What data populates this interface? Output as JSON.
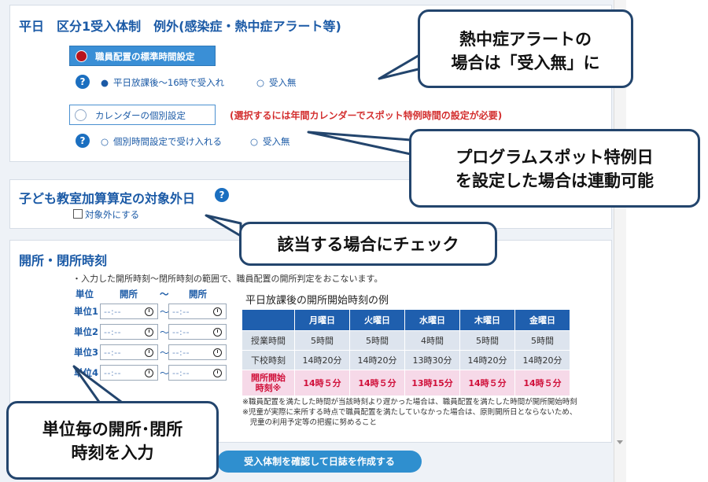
{
  "section1": {
    "title": "平日　区分1受入体制　例外(感染症・熱中症アラート等)",
    "standard_button": "職員配置の標準時間設定",
    "standard_options": [
      "平日放課後〜16時で受入れ",
      "受入無"
    ],
    "calendar_button": "カレンダーの個別設定",
    "calendar_warning": "(選択するには年間カレンダーでスポット特例時間の設定が必要)",
    "calendar_options": [
      "個別時間設定で受け入れる",
      "受入無"
    ],
    "help_icon": "?"
  },
  "section2": {
    "title": "子ども教室加算算定の対象外日",
    "checkbox_label": "対象外にする"
  },
  "section3": {
    "title": "開所・閉所時刻",
    "note": "・入力した開所時刻〜閉所時刻の範囲で、職員配置の開所判定をおこないます。",
    "headers": {
      "unit": "単位",
      "open": "開所",
      "tilde": "〜",
      "close": "開所"
    },
    "units": [
      "単位1",
      "単位2",
      "単位3",
      "単位4"
    ],
    "time_placeholder": "--:--",
    "example_title": "平日放課後の開所開始時刻の例",
    "table": {
      "days": [
        "月曜日",
        "火曜日",
        "水曜日",
        "木曜日",
        "金曜日"
      ],
      "rows": [
        {
          "label": "授業時間",
          "values": [
            "5時間",
            "5時間",
            "4時間",
            "5時間",
            "5時間"
          ]
        },
        {
          "label": "下校時刻",
          "values": [
            "14時20分",
            "14時20分",
            "13時30分",
            "14時20分",
            "14時20分"
          ]
        }
      ],
      "open_row": {
        "label_line1": "開所開始",
        "label_line2": "時刻※",
        "values": [
          "14時５分",
          "14時５分",
          "13時15分",
          "14時５分",
          "14時５分"
        ]
      }
    },
    "footnotes": [
      "※職員配置を満たした時間が当該時刻より遅かった場合は、職員配置を満たした時間が開所開始時刻",
      "※児童が実際に来所する時点で職員配置を満たしていなかった場合は、原則開所日とならないため、",
      "　児童の利用予定等の把握に努めること"
    ]
  },
  "submit_button": "受入体制を確認して日誌を作成する",
  "callouts": {
    "heat": [
      "熱中症アラートの",
      "場合は「受入無」に"
    ],
    "spot": [
      "プログラムスポット特例日",
      "を設定した場合は連動可能"
    ],
    "check": [
      "該当する場合にチェック"
    ],
    "unit": [
      "単位毎の開所･閉所",
      "時刻を入力"
    ]
  },
  "colors": {
    "accent": "#1b5aa6",
    "header": "#1f5fae",
    "warning": "#d32f2f",
    "callout_border": "#23456d"
  }
}
